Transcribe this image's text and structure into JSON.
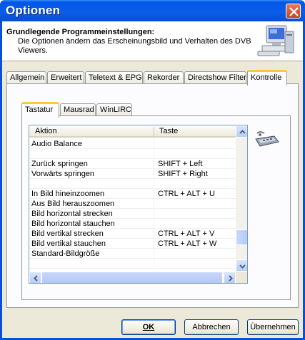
{
  "window": {
    "title": "Optionen"
  },
  "header": {
    "title": "Grundlegende Programmeinstellungen:",
    "description": "Die Optionen ändern das Erscheinungsbild und Verhalten des DVB Viewers."
  },
  "tabs": [
    {
      "label": "Allgemein"
    },
    {
      "label": "Erweitert"
    },
    {
      "label": "Teletext & EPG"
    },
    {
      "label": "Rekorder"
    },
    {
      "label": "Directshow Filter"
    },
    {
      "label": "Kontrolle",
      "active": true
    }
  ],
  "inner_tabs": [
    {
      "label": "Tastatur",
      "active": true
    },
    {
      "label": "Mausrad"
    },
    {
      "label": "WinLIRC"
    }
  ],
  "list": {
    "columns": {
      "action": "Aktion",
      "key": "Taste"
    },
    "rows": [
      {
        "action": "Audio Balance",
        "key": ""
      },
      {
        "action": "",
        "key": ""
      },
      {
        "action": "Zurück springen",
        "key": "SHIFT + Left"
      },
      {
        "action": "Vorwärts springen",
        "key": "SHIFT + Right"
      },
      {
        "action": "",
        "key": ""
      },
      {
        "action": "In Bild hineinzoomen",
        "key": "CTRL + ALT + U"
      },
      {
        "action": "Aus Bild herauszoomen",
        "key": ""
      },
      {
        "action": "Bild horizontal strecken",
        "key": ""
      },
      {
        "action": "Bild horizontal stauchen",
        "key": ""
      },
      {
        "action": "Bild vertikal strecken",
        "key": "CTRL + ALT + V"
      },
      {
        "action": "Bild vertikal stauchen",
        "key": "CTRL + ALT + W"
      },
      {
        "action": "Standard-Bildgröße",
        "key": ""
      },
      {
        "action": "",
        "key": ""
      }
    ]
  },
  "buttons": {
    "ok": "OK",
    "cancel": "Abbrechen",
    "apply": "Übernehmen"
  },
  "icons": {
    "header": "computer-settings-icon",
    "side": "keyboard-icon",
    "close": "close-icon"
  },
  "colors": {
    "titlebar": "#0058e6",
    "active_tab_accent": "#ffc83c",
    "close": "#c8431e"
  }
}
